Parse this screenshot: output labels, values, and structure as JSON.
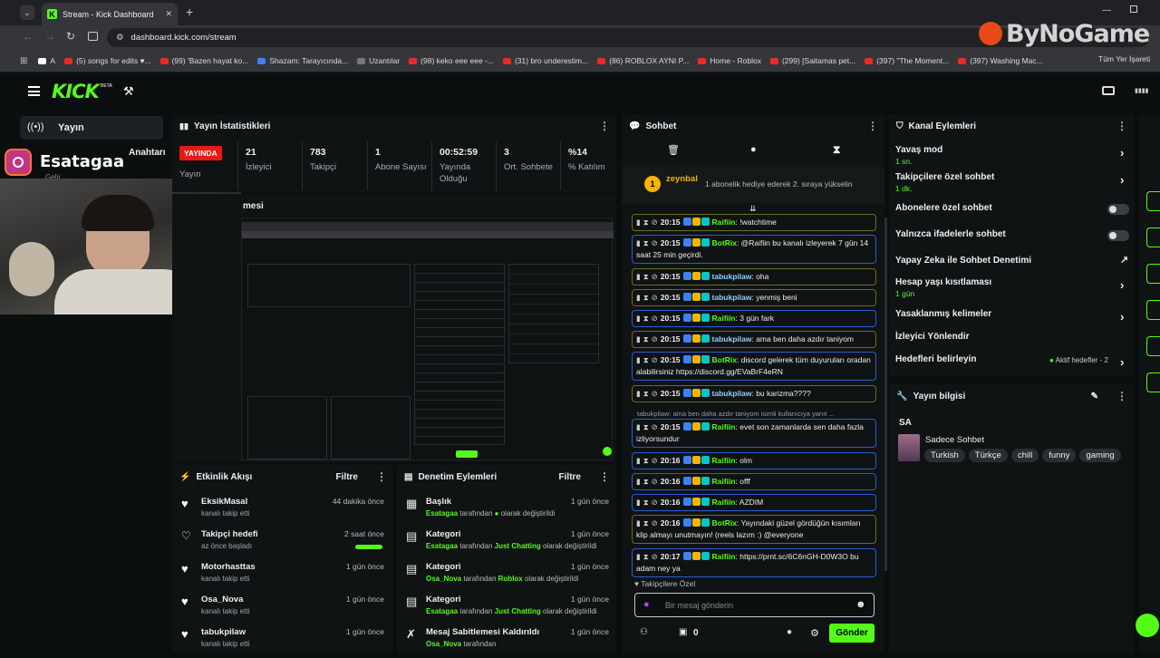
{
  "browser": {
    "tab_title": "Stream - Kick Dashboard",
    "url": "dashboard.kick.com/stream",
    "bookmarks": [
      "A",
      "(5) songs for edits ♥...",
      "(99) 'Bazen hayat ko...",
      "Shazam: Tarayıcında...",
      "Uzantılar",
      "(98) keko eee eee -...",
      "(31) bro underestim...",
      "(86) ROBLOX AYNI P...",
      "Home - Roblox",
      "(299) [Saitamas pet...",
      "(397) \"The Moment...",
      "(397) Washing Mac..."
    ],
    "all_bookmarks": "Tüm Yer İşareti"
  },
  "watermark": "ByNoGame",
  "overlay": {
    "instagram_handle": "Esatagaa"
  },
  "sidebar": {
    "item": "Yayın",
    "partial": "Anahtarı",
    "partial2": "Gelir"
  },
  "brand": {
    "logo": "KICK",
    "beta": "BETA"
  },
  "stats": {
    "title": "Yayın İstatistikleri",
    "live_badge": "YAYINDA",
    "live_label": "Yayın",
    "cells": [
      {
        "value": "21",
        "label": "İzleyici"
      },
      {
        "value": "783",
        "label": "Takipçi"
      },
      {
        "value": "1",
        "label": "Abone Sayısı"
      },
      {
        "value": "00:52:59",
        "label": "Yayında Olduğu"
      },
      {
        "value": "3",
        "label": "Ort. Sohbete"
      },
      {
        "value": "%14",
        "label": "% Katılım"
      }
    ]
  },
  "preview": {
    "title": "mesi"
  },
  "chat": {
    "title": "Sohbet",
    "pinned_user": "zeynbal",
    "pinned_text": "1 abonelik hediye ederek 2. sıraya yükselin",
    "messages": [
      {
        "time": "20:15",
        "user": "Raifiin",
        "text": "!watchtime",
        "color": "#53fc18",
        "border": "y"
      },
      {
        "time": "20:15",
        "user": "BotRix",
        "text": "@Raifiin bu kanalı izleyerek 7 gün 14 saat 25 min geçirdi.",
        "color": "#53fc18",
        "border": "b"
      },
      {
        "time": "20:15",
        "user": "tabukpilaw",
        "text": "oha",
        "color": "#8fd0ff",
        "border": "y"
      },
      {
        "time": "20:15",
        "user": "tabukpilaw",
        "text": "yenmiş beni",
        "color": "#8fd0ff",
        "border": "y"
      },
      {
        "time": "20:15",
        "user": "Raifiin",
        "text": "3 gün fark",
        "color": "#53fc18",
        "border": "b"
      },
      {
        "time": "20:15",
        "user": "tabukpilaw",
        "text": "ama ben daha azdır taniyom",
        "color": "#8fd0ff",
        "border": "y"
      },
      {
        "time": "20:15",
        "user": "BotRix",
        "text": "discord gelerek tüm duyuruları oradan alabilirsiniz https://discord.gg/EVaBrF4eRN",
        "color": "#53fc18",
        "border": "b"
      },
      {
        "time": "20:15",
        "user": "tabukpilaw",
        "text": "bu karizma????",
        "color": "#8fd0ff",
        "border": "y"
      },
      {
        "time": "20:15",
        "user": "Raifiin",
        "text": "evet son zamanlarda sen daha fazla izliyorsundur",
        "color": "#53fc18",
        "border": "b",
        "reply": "tabukpilaw: ama ben daha azdır taniyom isimli kullanıcıya yanıt ..."
      },
      {
        "time": "20:16",
        "user": "Raifiin",
        "text": "olm",
        "color": "#53fc18",
        "border": "b"
      },
      {
        "time": "20:16",
        "user": "Raifiin",
        "text": "offf",
        "color": "#53fc18",
        "border": "b"
      },
      {
        "time": "20:16",
        "user": "Raifiin",
        "text": "AZDIM",
        "color": "#53fc18",
        "border": "b"
      },
      {
        "time": "20:16",
        "user": "BotRix",
        "text": "Yayındaki güzel gördüğün kısımları klip almayı unutmayın! (reels lazım :) @everyone",
        "color": "#53fc18",
        "border": "y"
      },
      {
        "time": "20:17",
        "user": "Raifiin",
        "text": "https://prnt.sc/6C6nGH-D0W3O bu adam ney ya",
        "color": "#53fc18",
        "border": "b"
      }
    ],
    "followers_only": "Takipçilere Özel",
    "input_placeholder": "Bir mesaj gönderin",
    "points": "0",
    "send_button": "Gönder"
  },
  "channel_actions": {
    "title": "Kanal Eylemleri",
    "items": [
      {
        "label": "Yavaş mod",
        "sub": "1 sn."
      },
      {
        "label": "Takipçilere özel sohbet",
        "sub": "1 dk."
      },
      {
        "label": "Abonelere özel sohbet",
        "sub": ""
      },
      {
        "label": "Yalnızca ifadelerle sohbet",
        "sub": ""
      },
      {
        "label": "Yapay Zeka ile Sohbet Denetimi",
        "sub": ""
      },
      {
        "label": "Hesap yaşı kısıtlaması",
        "sub": "1 gün"
      },
      {
        "label": "Yasaklanmış kelimeler",
        "sub": ""
      },
      {
        "label": "İzleyici Yönlendir",
        "sub": ""
      },
      {
        "label": "Hedefleri belirleyin",
        "sub": ""
      }
    ],
    "goals_status": "Aktif hedefler - 2"
  },
  "stream_info": {
    "title": "Yayın bilgisi",
    "stream_title": "SA",
    "category": "Sadece Sohbet",
    "tags": [
      "Turkish",
      "Türkçe",
      "chill",
      "funny",
      "gaming"
    ]
  },
  "activity": {
    "title": "Etkinlik Akışı",
    "filter": "Filtre",
    "items": [
      {
        "name": "EksikMasal",
        "desc": "kanalı takip etti",
        "when": "44 dakika önce"
      },
      {
        "name": "Takipçi hedefi",
        "desc": "az önce başladı",
        "when": "2 saat önce"
      },
      {
        "name": "Motorhasttas",
        "desc": "kanalı takip etti",
        "when": "1 gün önce"
      },
      {
        "name": "Osa_Nova",
        "desc": "kanalı takip etti",
        "when": "1 gün önce"
      },
      {
        "name": "tabukpilaw",
        "desc": "kanalı takip etti",
        "when": "1 gün önce"
      }
    ]
  },
  "moderation": {
    "title": "Denetim Eylemleri",
    "filter": "Filtre",
    "items": [
      {
        "name": "Başlık",
        "who": "Esatagaa",
        "mid": "tarafından",
        "val": "●",
        "end": "olarak değiştirildi",
        "when": "1 gün önce"
      },
      {
        "name": "Kategori",
        "who": "Esatagaa",
        "mid": "tarafından",
        "val": "Just Chatting",
        "end": "olarak değiştirildi",
        "when": "1 gün önce"
      },
      {
        "name": "Kategori",
        "who": "Osa_Nova",
        "mid": "tarafından",
        "val": "Roblox",
        "end": "olarak değiştirildi",
        "when": "1 gün önce"
      },
      {
        "name": "Kategori",
        "who": "Esatagaa",
        "mid": "tarafından",
        "val": "Just Chatting",
        "end": "olarak değiştirildi",
        "when": "1 gün önce"
      },
      {
        "name": "Mesaj Sabitlemesi Kaldırıldı",
        "who": "Osa_Nova",
        "mid": "tarafından",
        "val": "",
        "end": "",
        "when": "1 gün önce"
      }
    ]
  }
}
